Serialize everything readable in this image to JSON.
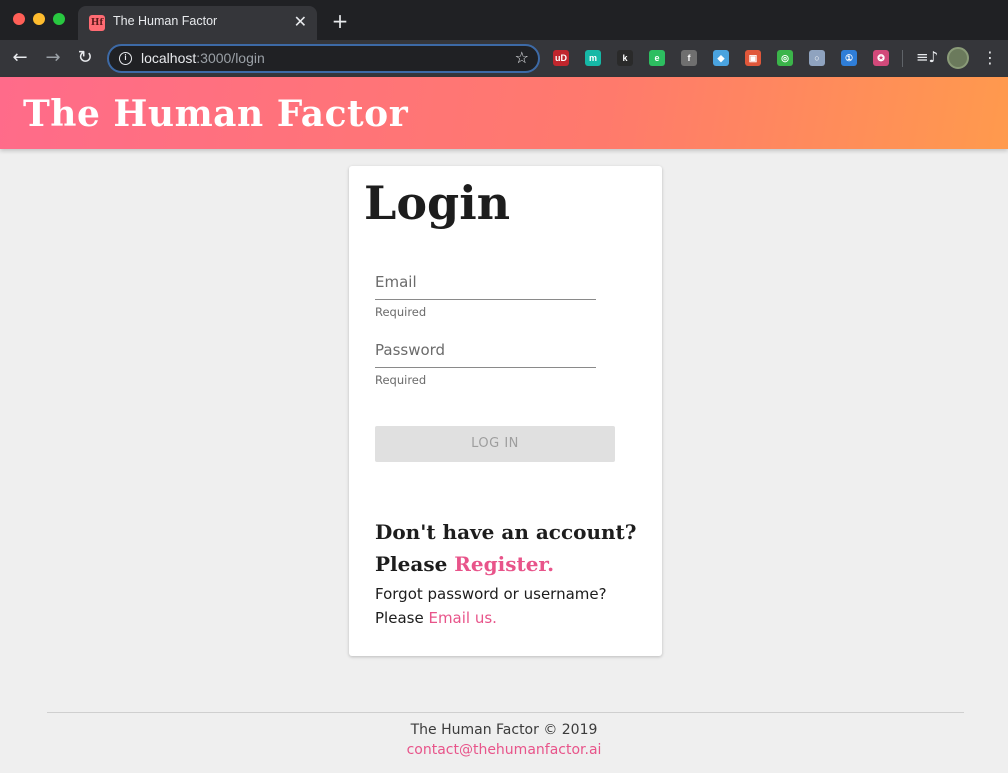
{
  "browser": {
    "tab_title": "The Human Factor",
    "tab_favicon_text": "Hf",
    "tab_close": "✕",
    "new_tab": "+",
    "url_host": "localhost",
    "url_path": ":3000/login"
  },
  "extensions": [
    {
      "name": "ublock-icon",
      "glyph": "uD",
      "color": "#c0262d"
    },
    {
      "name": "mercury-icon",
      "glyph": "m",
      "color": "#16b8a6"
    },
    {
      "name": "kindle-icon",
      "glyph": "k",
      "color": "#2a2a2a"
    },
    {
      "name": "evernote-icon",
      "glyph": "e",
      "color": "#2dbe60"
    },
    {
      "name": "facebook-icon",
      "glyph": "f",
      "color": "#6f6f6f"
    },
    {
      "name": "diamond-icon",
      "glyph": "◆",
      "color": "#4aa3df"
    },
    {
      "name": "devtools-icon",
      "glyph": "▣",
      "color": "#e0573a"
    },
    {
      "name": "target-icon",
      "glyph": "◎",
      "color": "#3bb54a"
    },
    {
      "name": "ring-icon",
      "glyph": "○",
      "color": "#8fa3bf"
    },
    {
      "name": "onepassword-icon",
      "glyph": "①",
      "color": "#2f7ed8"
    },
    {
      "name": "star-badge-icon",
      "glyph": "✪",
      "color": "#d2497a"
    }
  ],
  "header": {
    "site_title": "The Human Factor"
  },
  "login": {
    "heading": "Login",
    "email_placeholder": "Email",
    "email_helper": "Required",
    "password_placeholder": "Password",
    "password_helper": "Required",
    "submit_label": "LOG IN",
    "no_account_text": "Don't have an account?",
    "please_text": "Please",
    "register_link": "Register.",
    "forgot_text": "Forgot password or username?",
    "please_text_2": "Please",
    "email_us_link": "Email us."
  },
  "footer": {
    "copyright": "The Human Factor © 2019",
    "contact_email": "contact@thehumanfactor.ai"
  },
  "colors": {
    "accent_pink": "#e8548a",
    "header_gradient_start": "#ff6b8a",
    "header_gradient_end": "#ff9a4d"
  }
}
